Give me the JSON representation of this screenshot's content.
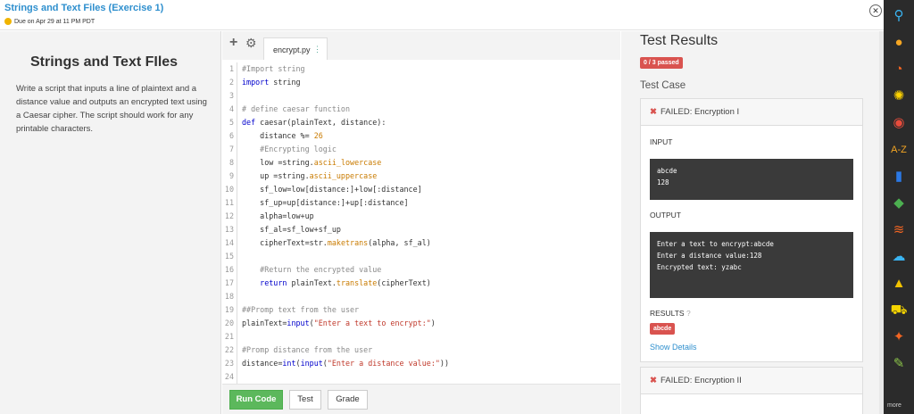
{
  "header": {
    "title": "Strings and Text Files (Exercise 1)",
    "due": "Due on Apr 29 at 11 PM PDT"
  },
  "instructions": {
    "title": "Strings and Text FIles",
    "body": "Write a script that inputs a line of plaintext and a distance value and outputs an encrypted text using a Caesar cipher. The script should work for any printable characters."
  },
  "editor": {
    "file_tab": "encrypt.py",
    "lines": [
      {
        "n": "1",
        "t": "#Import string"
      },
      {
        "n": "2",
        "t": "import string"
      },
      {
        "n": "3",
        "t": ""
      },
      {
        "n": "4",
        "t": "# define caesar function"
      },
      {
        "n": "5",
        "t": "def caesar(plainText, distance):"
      },
      {
        "n": "6",
        "t": "    distance %= 26"
      },
      {
        "n": "7",
        "t": "    #Encrypting logic"
      },
      {
        "n": "8",
        "t": "    low =string.ascii_lowercase"
      },
      {
        "n": "9",
        "t": "    up =string.ascii_uppercase"
      },
      {
        "n": "10",
        "t": "    sf_low=low[distance:]+low[:distance]"
      },
      {
        "n": "11",
        "t": "    sf_up=up[distance:]+up[:distance]"
      },
      {
        "n": "12",
        "t": "    alpha=low+up"
      },
      {
        "n": "13",
        "t": "    sf_al=sf_low+sf_up"
      },
      {
        "n": "14",
        "t": "    cipherText=str.maketrans(alpha, sf_al)"
      },
      {
        "n": "15",
        "t": ""
      },
      {
        "n": "16",
        "t": "    #Return the encrypted value"
      },
      {
        "n": "17",
        "t": "    return plainText.translate(cipherText)"
      },
      {
        "n": "18",
        "t": ""
      },
      {
        "n": "19",
        "t": "##Promp text from the user"
      },
      {
        "n": "20",
        "t": "plainText=input(\"Enter a text to encrypt:\")"
      },
      {
        "n": "21",
        "t": ""
      },
      {
        "n": "22",
        "t": "#Promp distance from the user"
      },
      {
        "n": "23",
        "t": "distance=int(input(\"Enter a distance value:\"))"
      },
      {
        "n": "24",
        "t": ""
      }
    ],
    "run_label": "Run Code",
    "test_label": "Test",
    "grade_label": "Grade"
  },
  "results": {
    "title": "Test Results",
    "passed_badge": "0 / 3 passed",
    "test_case_label": "Test Case",
    "case1": {
      "status": "FAILED: Encryption I",
      "input_label": "INPUT",
      "input_text": "abcde\n128",
      "output_label": "OUTPUT",
      "output_text": "Enter a text to encrypt:abcde\nEnter a distance value:128\nEncrypted text: yzabc",
      "results_label": "RESULTS",
      "result_badge": "abcde",
      "show_details": "Show Details"
    },
    "case2": {
      "status": "FAILED: Encryption II"
    }
  },
  "dock": {
    "more_label": "more"
  },
  "colors": {
    "accent": "#2e8fce",
    "fail": "#d9534f",
    "run": "#5cb85c",
    "keyword": "#0000cc",
    "comment": "#8a8a8a",
    "string": "#c0392b",
    "method": "#c97b00"
  }
}
